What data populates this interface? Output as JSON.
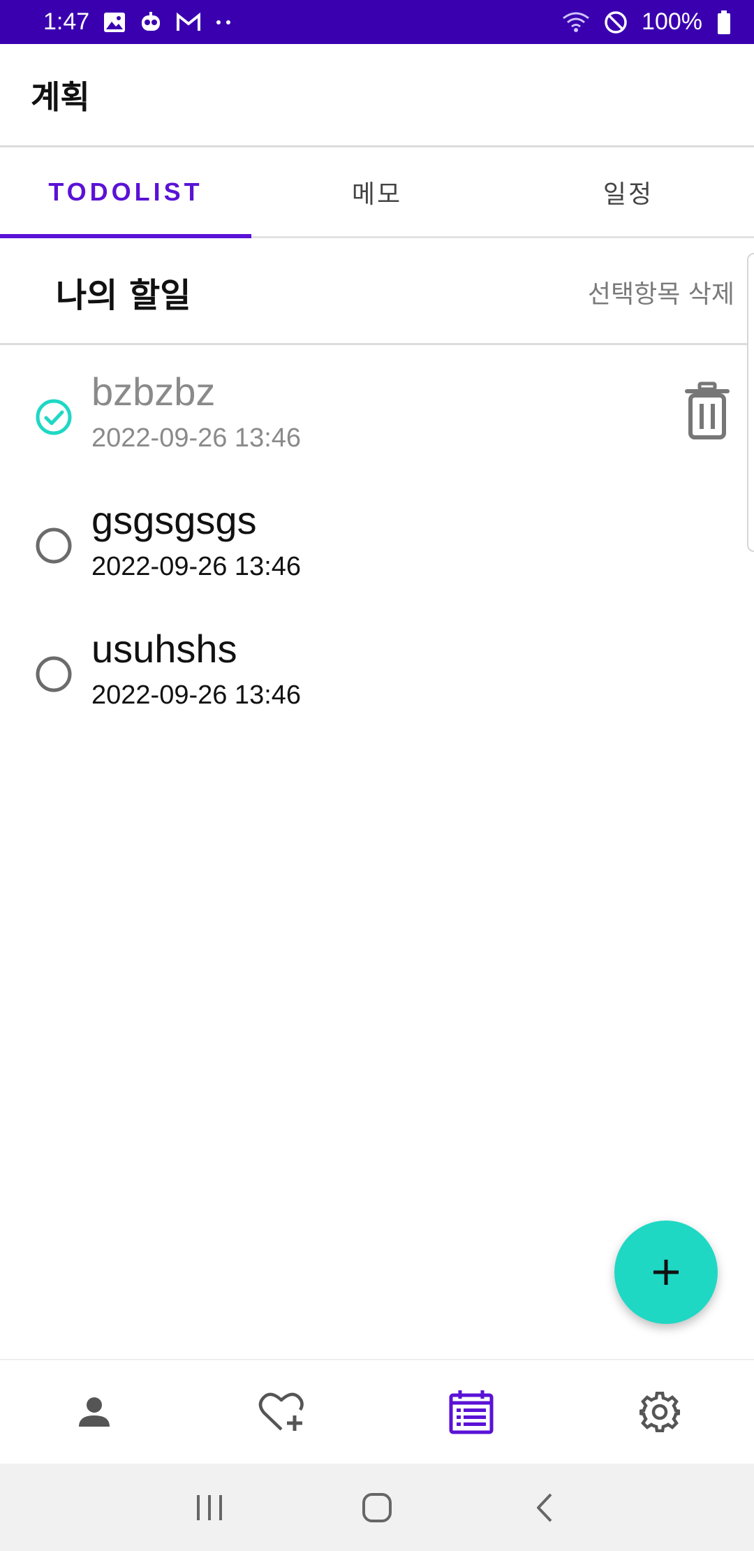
{
  "status_bar": {
    "time": "1:47",
    "battery": "100%",
    "icons": [
      "image-icon",
      "robot-face-icon",
      "gmail-icon",
      "more-dots-icon",
      "wifi-icon",
      "do-not-disturb-icon",
      "battery-icon"
    ]
  },
  "app_bar": {
    "title": "계획"
  },
  "tabs": [
    {
      "label": "TODOLIST",
      "active": true
    },
    {
      "label": "메모",
      "active": false
    },
    {
      "label": "일정",
      "active": false
    }
  ],
  "list_header": {
    "title": "나의 할일",
    "delete_selected_label": "선택항목 삭제"
  },
  "todos": [
    {
      "title": "bzbzbz",
      "date": "2022-09-26 13:46",
      "checked": true
    },
    {
      "title": "gsgsgsgs",
      "date": "2022-09-26 13:46",
      "checked": false
    },
    {
      "title": "usuhshs",
      "date": "2022-09-26 13:46",
      "checked": false
    }
  ],
  "fab": {
    "icon": "plus-icon"
  },
  "bottom_nav": [
    {
      "icon": "person-icon",
      "active": false
    },
    {
      "icon": "heart-plus-icon",
      "active": false
    },
    {
      "icon": "calendar-list-icon",
      "active": true
    },
    {
      "icon": "settings-icon",
      "active": false
    }
  ],
  "colors": {
    "status_bar": "#3a00b0",
    "accent": "#5a12d6",
    "fab": "#1ed8c4",
    "check": "#1ed8c4"
  }
}
